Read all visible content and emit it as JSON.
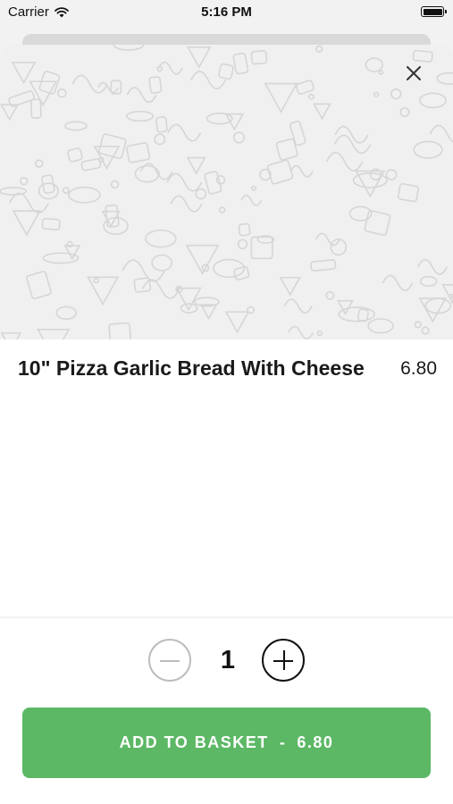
{
  "status_bar": {
    "carrier": "Carrier",
    "time": "5:16 PM",
    "battery_level": 1.0,
    "wifi_icon": "wifi-icon",
    "battery_icon": "battery-icon"
  },
  "modal": {
    "close_icon": "close-icon",
    "hero_image": "food-doodle-pattern",
    "item": {
      "name": "10\" Pizza Garlic Bread With Cheese",
      "price": "6.80"
    },
    "quantity": {
      "value": "1",
      "minus_icon": "minus-icon",
      "plus_icon": "plus-icon"
    },
    "add_button": {
      "label": "ADD TO BASKET",
      "separator": "-",
      "total": "6.80",
      "color": "#5cb865"
    }
  }
}
